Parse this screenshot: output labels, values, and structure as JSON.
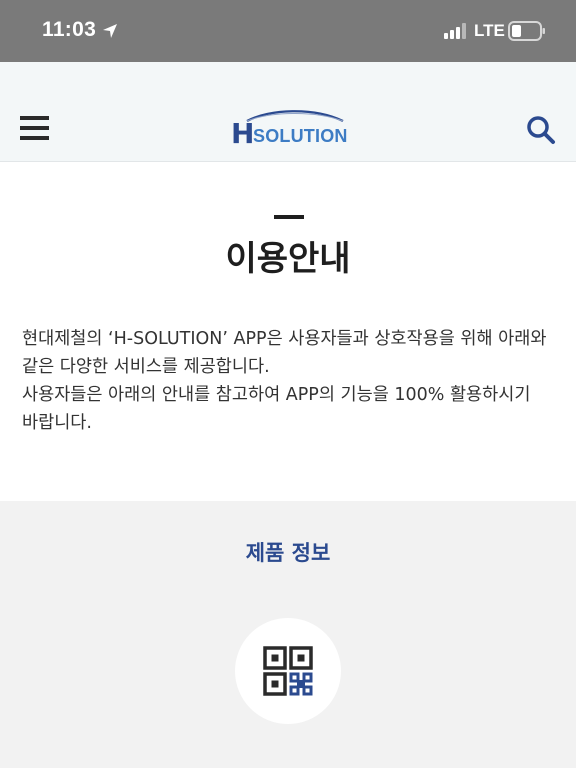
{
  "status_bar": {
    "time": "11:03",
    "network": "LTE"
  },
  "header": {
    "logo_h": "H",
    "logo_text": "SOLUTION"
  },
  "intro": {
    "title": "이용안내",
    "paragraph_lines": [
      "현대제철의 ‘H-SOLUTION’ APP은 사용자들과 상호작용을 위해 아래와",
      "같은 다양한 서비스를 제공합니다.",
      "사용자들은 아래의 안내를 참고하여 APP의 기능을 100% 활용하시기",
      "바랍니다."
    ]
  },
  "product": {
    "title": "제품 정보"
  },
  "colors": {
    "status_bar_bg": "#7a7a7a",
    "header_bg": "#f3f7f8",
    "brand_blue": "#2b4a8f",
    "section_bg": "#f2f2f2"
  },
  "icons": [
    "location-arrow-icon",
    "signal-icon",
    "battery-icon",
    "menu-icon",
    "search-icon",
    "qr-code-icon"
  ]
}
